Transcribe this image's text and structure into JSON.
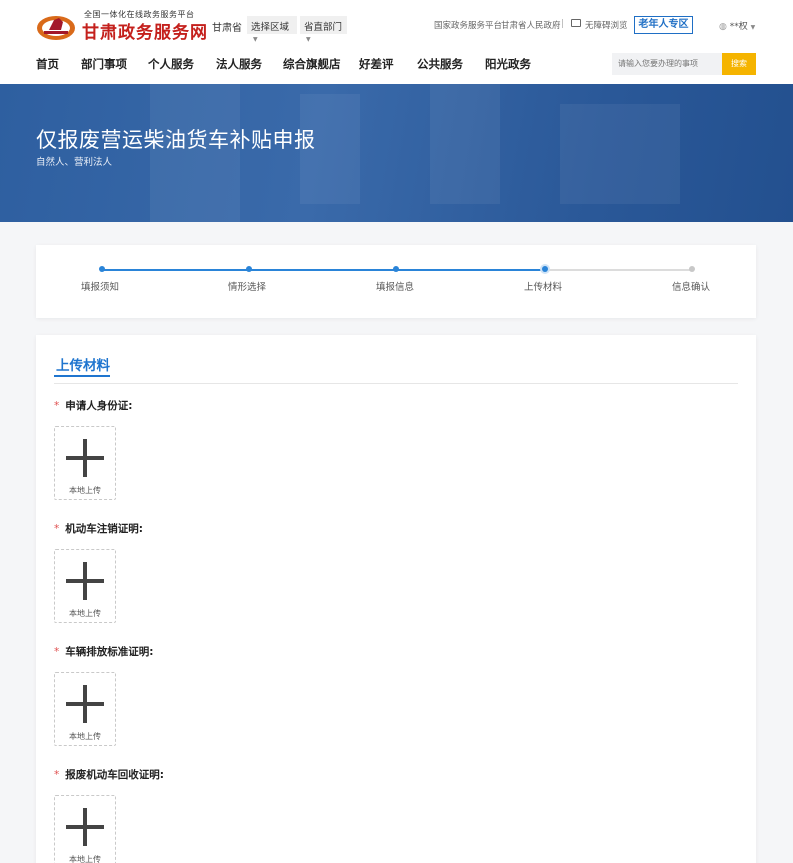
{
  "header": {
    "logo_subtitle": "全国一体化在线政务服务平台",
    "logo_title": "甘肃政务服务网",
    "province": "甘肃省",
    "region_select": "选择区域",
    "dept_select": "省直部门",
    "link_national": "国家政务服务平台",
    "link_gov": "甘肃省人民政府",
    "separator": "|",
    "accessibility": "无障碍浏览",
    "elder_mode": "老年人专区",
    "user": "**权"
  },
  "nav": {
    "items": [
      {
        "label": "首页"
      },
      {
        "label": "部门事项"
      },
      {
        "label": "个人服务"
      },
      {
        "label": "法人服务"
      },
      {
        "label": "综合旗舰店"
      },
      {
        "label": "好差评"
      },
      {
        "label": "公共服务"
      },
      {
        "label": "阳光政务"
      }
    ],
    "search_placeholder": "请输入您要办理的事项",
    "search_button": "搜索"
  },
  "banner": {
    "title": "仅报废营运柴油货车补贴申报",
    "subtitle": "自然人、营利法人"
  },
  "steps": {
    "items": [
      {
        "label": "填报须知",
        "status": "done"
      },
      {
        "label": "情形选择",
        "status": "done"
      },
      {
        "label": "填报信息",
        "status": "done"
      },
      {
        "label": "上传材料",
        "status": "active"
      },
      {
        "label": "信息确认",
        "status": "todo"
      }
    ]
  },
  "upload": {
    "section_title": "上传材料",
    "upload_label": "本地上传",
    "fields": [
      {
        "label": "申请人身份证:"
      },
      {
        "label": "机动车注销证明:"
      },
      {
        "label": "车辆排放标准证明:"
      },
      {
        "label": "报废机动车回收证明:"
      }
    ]
  },
  "colors": {
    "primary": "#1f75cf",
    "brand_red": "#c4201c",
    "search_button": "#f5b400",
    "banner": "#2e5fa0",
    "required": "#e05050"
  }
}
